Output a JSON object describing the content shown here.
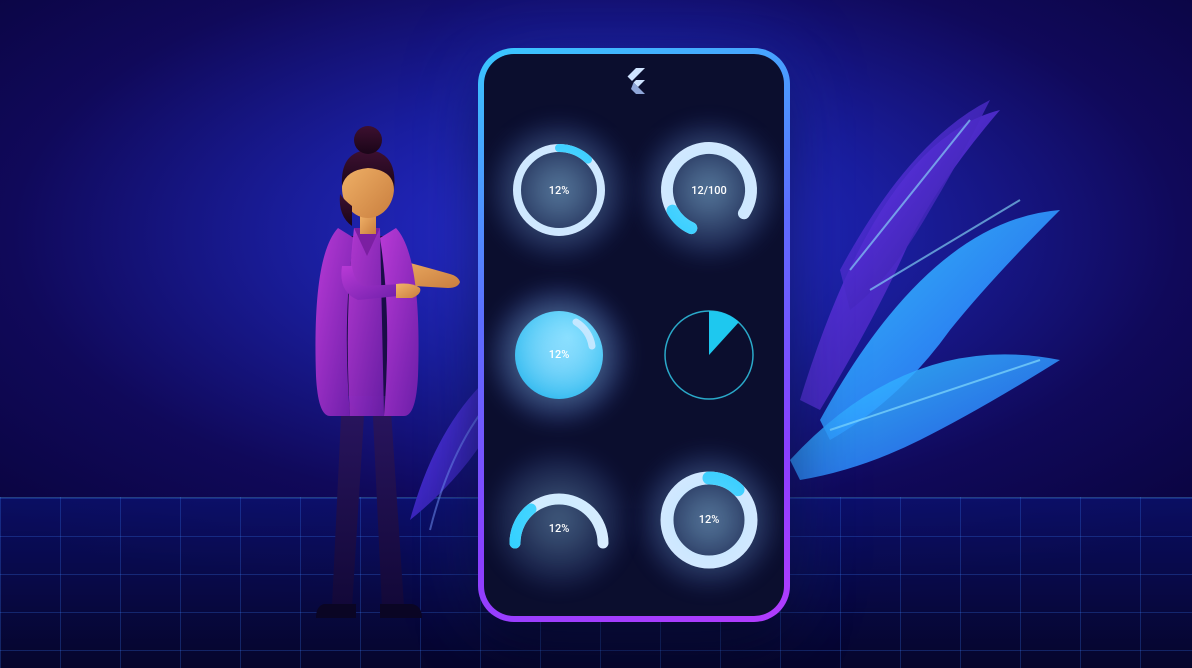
{
  "gauges": [
    {
      "label": "12%",
      "percent": 12,
      "style": "ring-thin"
    },
    {
      "label": "12/100",
      "percent": 12,
      "style": "ring-open"
    },
    {
      "label": "12%",
      "percent": 12,
      "style": "fill-circle"
    },
    {
      "label": "",
      "percent": 12,
      "style": "pie-outline"
    },
    {
      "label": "12%",
      "percent": 12,
      "style": "arc-half"
    },
    {
      "label": "12%",
      "percent": 12,
      "style": "ring-thick"
    }
  ],
  "icon": "flutter-logo",
  "colors": {
    "accent": "#29d7ff",
    "ring": "#ffffff",
    "screen": "#0b0e2e"
  }
}
